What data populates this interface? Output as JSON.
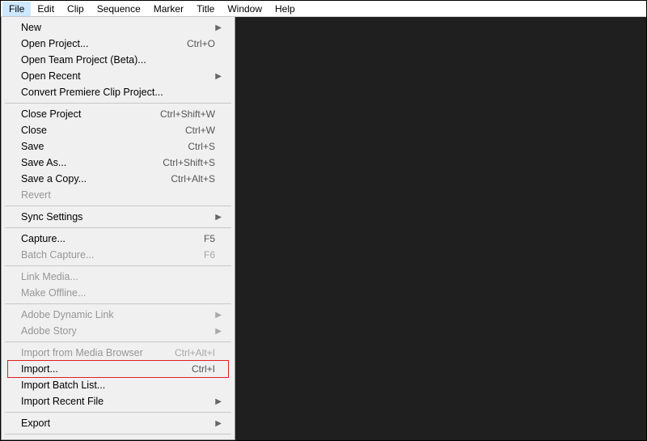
{
  "menubar": [
    "File",
    "Edit",
    "Clip",
    "Sequence",
    "Marker",
    "Title",
    "Window",
    "Help"
  ],
  "menubar_selected": 0,
  "dropdown": [
    {
      "type": "item",
      "label": "New",
      "shortcut": "",
      "submenu": true,
      "disabled": false
    },
    {
      "type": "item",
      "label": "Open Project...",
      "shortcut": "Ctrl+O",
      "submenu": false,
      "disabled": false
    },
    {
      "type": "item",
      "label": "Open Team Project (Beta)...",
      "shortcut": "",
      "submenu": false,
      "disabled": false
    },
    {
      "type": "item",
      "label": "Open Recent",
      "shortcut": "",
      "submenu": true,
      "disabled": false
    },
    {
      "type": "item",
      "label": "Convert Premiere Clip Project...",
      "shortcut": "",
      "submenu": false,
      "disabled": false
    },
    {
      "type": "sep"
    },
    {
      "type": "item",
      "label": "Close Project",
      "shortcut": "Ctrl+Shift+W",
      "submenu": false,
      "disabled": false
    },
    {
      "type": "item",
      "label": "Close",
      "shortcut": "Ctrl+W",
      "submenu": false,
      "disabled": false
    },
    {
      "type": "item",
      "label": "Save",
      "shortcut": "Ctrl+S",
      "submenu": false,
      "disabled": false
    },
    {
      "type": "item",
      "label": "Save As...",
      "shortcut": "Ctrl+Shift+S",
      "submenu": false,
      "disabled": false
    },
    {
      "type": "item",
      "label": "Save a Copy...",
      "shortcut": "Ctrl+Alt+S",
      "submenu": false,
      "disabled": false
    },
    {
      "type": "item",
      "label": "Revert",
      "shortcut": "",
      "submenu": false,
      "disabled": true
    },
    {
      "type": "sep"
    },
    {
      "type": "item",
      "label": "Sync Settings",
      "shortcut": "",
      "submenu": true,
      "disabled": false
    },
    {
      "type": "sep"
    },
    {
      "type": "item",
      "label": "Capture...",
      "shortcut": "F5",
      "submenu": false,
      "disabled": false
    },
    {
      "type": "item",
      "label": "Batch Capture...",
      "shortcut": "F6",
      "submenu": false,
      "disabled": true
    },
    {
      "type": "sep"
    },
    {
      "type": "item",
      "label": "Link Media...",
      "shortcut": "",
      "submenu": false,
      "disabled": true
    },
    {
      "type": "item",
      "label": "Make Offline...",
      "shortcut": "",
      "submenu": false,
      "disabled": true
    },
    {
      "type": "sep"
    },
    {
      "type": "item",
      "label": "Adobe Dynamic Link",
      "shortcut": "",
      "submenu": true,
      "disabled": true
    },
    {
      "type": "item",
      "label": "Adobe Story",
      "shortcut": "",
      "submenu": true,
      "disabled": true
    },
    {
      "type": "sep"
    },
    {
      "type": "item",
      "label": "Import from Media Browser",
      "shortcut": "Ctrl+Alt+I",
      "submenu": false,
      "disabled": true
    },
    {
      "type": "item",
      "label": "Import...",
      "shortcut": "Ctrl+I",
      "submenu": false,
      "disabled": false,
      "highlight": true
    },
    {
      "type": "item",
      "label": "Import Batch List...",
      "shortcut": "",
      "submenu": false,
      "disabled": false
    },
    {
      "type": "item",
      "label": "Import Recent File",
      "shortcut": "",
      "submenu": true,
      "disabled": false
    },
    {
      "type": "sep"
    },
    {
      "type": "item",
      "label": "Export",
      "shortcut": "",
      "submenu": true,
      "disabled": false
    },
    {
      "type": "sep"
    }
  ]
}
